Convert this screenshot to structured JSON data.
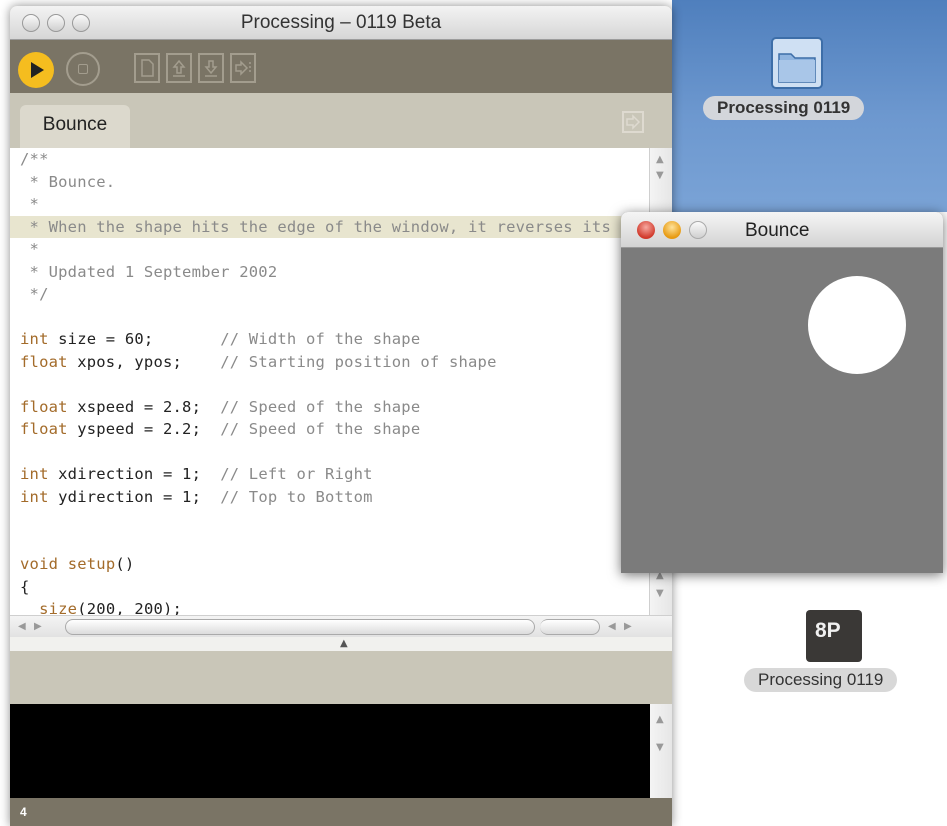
{
  "desktop": {
    "folder_label": "Processing 0119",
    "app_label": "Processing 0119",
    "app_icon_glyph": "8P"
  },
  "main_window": {
    "title": "Processing – 0119 Beta",
    "tab_name": "Bounce",
    "status_line": "4",
    "toolbar": {
      "run_icon": "play-icon",
      "stop_icon": "stop-icon",
      "new_icon": "new-file-icon",
      "open_icon": "open-icon",
      "save_icon": "save-icon",
      "export_icon": "export-icon"
    },
    "colors": {
      "toolbar": "#7a7465",
      "run_button": "#f5bd1f",
      "panel": "#c9c6b8",
      "keyword": "#a36b2a",
      "comment": "#8a8a8a"
    }
  },
  "code": {
    "lines": [
      [
        {
          "t": "/**",
          "c": "comment"
        }
      ],
      [
        {
          "t": " * Bounce.",
          "c": "comment"
        }
      ],
      [
        {
          "t": " *",
          "c": "comment"
        }
      ],
      [
        {
          "t": " * When the shape hits the edge of the window, it reverses its direction.",
          "c": "comment"
        }
      ],
      [
        {
          "t": " *",
          "c": "comment"
        }
      ],
      [
        {
          "t": " * Updated 1 September 2002",
          "c": "comment"
        }
      ],
      [
        {
          "t": " */",
          "c": "comment"
        }
      ],
      [],
      [
        {
          "t": "int",
          "c": "kw"
        },
        {
          "t": " size = 60;       ",
          "c": ""
        },
        {
          "t": "// Width of the shape",
          "c": "comment"
        }
      ],
      [
        {
          "t": "float",
          "c": "kw"
        },
        {
          "t": " xpos, ypos;    ",
          "c": ""
        },
        {
          "t": "// Starting position of shape",
          "c": "comment"
        }
      ],
      [],
      [
        {
          "t": "float",
          "c": "kw"
        },
        {
          "t": " xspeed = 2.8;  ",
          "c": ""
        },
        {
          "t": "// Speed of the shape",
          "c": "comment"
        }
      ],
      [
        {
          "t": "float",
          "c": "kw"
        },
        {
          "t": " yspeed = 2.2;  ",
          "c": ""
        },
        {
          "t": "// Speed of the shape",
          "c": "comment"
        }
      ],
      [],
      [
        {
          "t": "int",
          "c": "kw"
        },
        {
          "t": " xdirection = 1;  ",
          "c": ""
        },
        {
          "t": "// Left or Right",
          "c": "comment"
        }
      ],
      [
        {
          "t": "int",
          "c": "kw"
        },
        {
          "t": " ydirection = 1;  ",
          "c": ""
        },
        {
          "t": "// Top to Bottom",
          "c": "comment"
        }
      ],
      [],
      [],
      [
        {
          "t": "void",
          "c": "kw"
        },
        {
          "t": " ",
          "c": ""
        },
        {
          "t": "setup",
          "c": "fn"
        },
        {
          "t": "()",
          "c": ""
        }
      ],
      [
        {
          "t": "{",
          "c": ""
        }
      ],
      [
        {
          "t": "  ",
          "c": ""
        },
        {
          "t": "size",
          "c": "fn"
        },
        {
          "t": "(200, 200);",
          "c": ""
        }
      ]
    ],
    "highlighted_line": 3
  },
  "bounce_window": {
    "title": "Bounce",
    "canvas_color": "#7b7b7b",
    "ball_color": "#ffffff"
  }
}
